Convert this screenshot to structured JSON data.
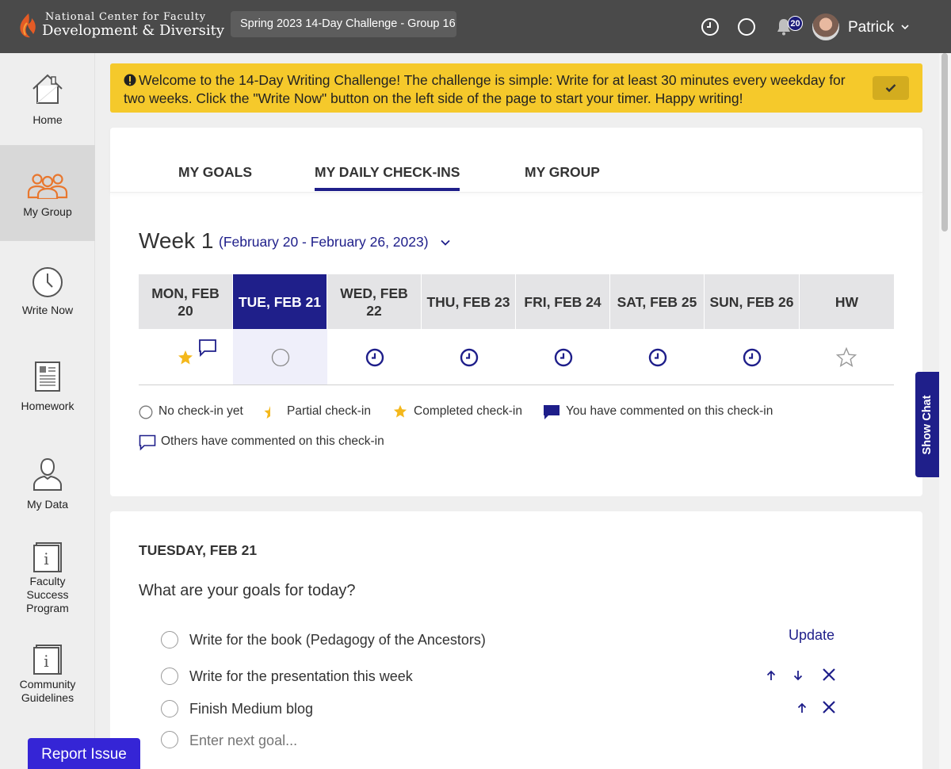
{
  "header": {
    "logo_line1": "National Center for Faculty",
    "logo_line2": "Development & Diversity",
    "group_label": "Spring 2023 14-Day Challenge - Group 16",
    "notification_count": "20",
    "user_name": "Patrick"
  },
  "sidebar": {
    "items": [
      {
        "label": "Home",
        "icon": "home-icon"
      },
      {
        "label": "My Group",
        "icon": "group-icon",
        "active": true
      },
      {
        "label": "Write Now",
        "icon": "clock-icon"
      },
      {
        "label": "Homework",
        "icon": "document-icon"
      },
      {
        "label": "My Data",
        "icon": "person-icon"
      },
      {
        "label": "Faculty Success Program",
        "label_lines": [
          "Faculty",
          "Success",
          "Program"
        ],
        "icon": "info-icon"
      },
      {
        "label": "Community Guidelines",
        "label_lines": [
          "Community",
          "Guidelines"
        ],
        "icon": "info-icon"
      }
    ]
  },
  "banner": {
    "text": "Welcome to the 14-Day Writing Challenge! The challenge is simple: Write for at least 30 minutes every weekday for two weeks. Click the \"Write Now\" button on the left side of the page to start your timer. Happy writing!"
  },
  "tabs": [
    {
      "label": "MY GOALS"
    },
    {
      "label": "MY DAILY CHECK-INS",
      "active": true
    },
    {
      "label": "MY GROUP"
    }
  ],
  "week": {
    "title": "Week 1",
    "range": "(February 20 - February 26, 2023)"
  },
  "days": [
    {
      "label_lines": [
        "MON, FEB",
        "20"
      ],
      "status": "completed-commented"
    },
    {
      "label_lines": [
        "TUE, FEB 21"
      ],
      "status": "none",
      "active": true
    },
    {
      "label_lines": [
        "WED, FEB",
        "22"
      ],
      "status": "upcoming"
    },
    {
      "label_lines": [
        "THU, FEB 23"
      ],
      "status": "upcoming"
    },
    {
      "label_lines": [
        "FRI, FEB 24"
      ],
      "status": "upcoming"
    },
    {
      "label_lines": [
        "SAT, FEB 25"
      ],
      "status": "upcoming"
    },
    {
      "label_lines": [
        "SUN, FEB 26"
      ],
      "status": "upcoming"
    },
    {
      "label_lines": [
        "HW"
      ],
      "status": "empty-star"
    }
  ],
  "legend": {
    "none": "No check-in yet",
    "partial": "Partial check-in",
    "completed": "Completed check-in",
    "you_commented": "You have commented on this check-in",
    "others_commented": "Others have commented on this check-in"
  },
  "daily": {
    "date": "TUESDAY, FEB 21",
    "question": "What are your goals for today?",
    "update_label": "Update",
    "goals": [
      {
        "text": "Write for the book (Pedagogy of the Ancestors)"
      },
      {
        "text": "Write for the presentation this week"
      },
      {
        "text": "Finish Medium blog"
      }
    ],
    "next_goal_placeholder": "Enter next goal..."
  },
  "show_chat_label": "Show Chat",
  "report_issue_label": "Report Issue",
  "colors": {
    "header_bg": "#4a4a4a",
    "brand_navy": "#1f1f8a",
    "banner_yellow": "#f5c92b",
    "report_blue": "#3525d6",
    "star_gold": "#f4b81c",
    "nav_orange": "#e8772e"
  }
}
